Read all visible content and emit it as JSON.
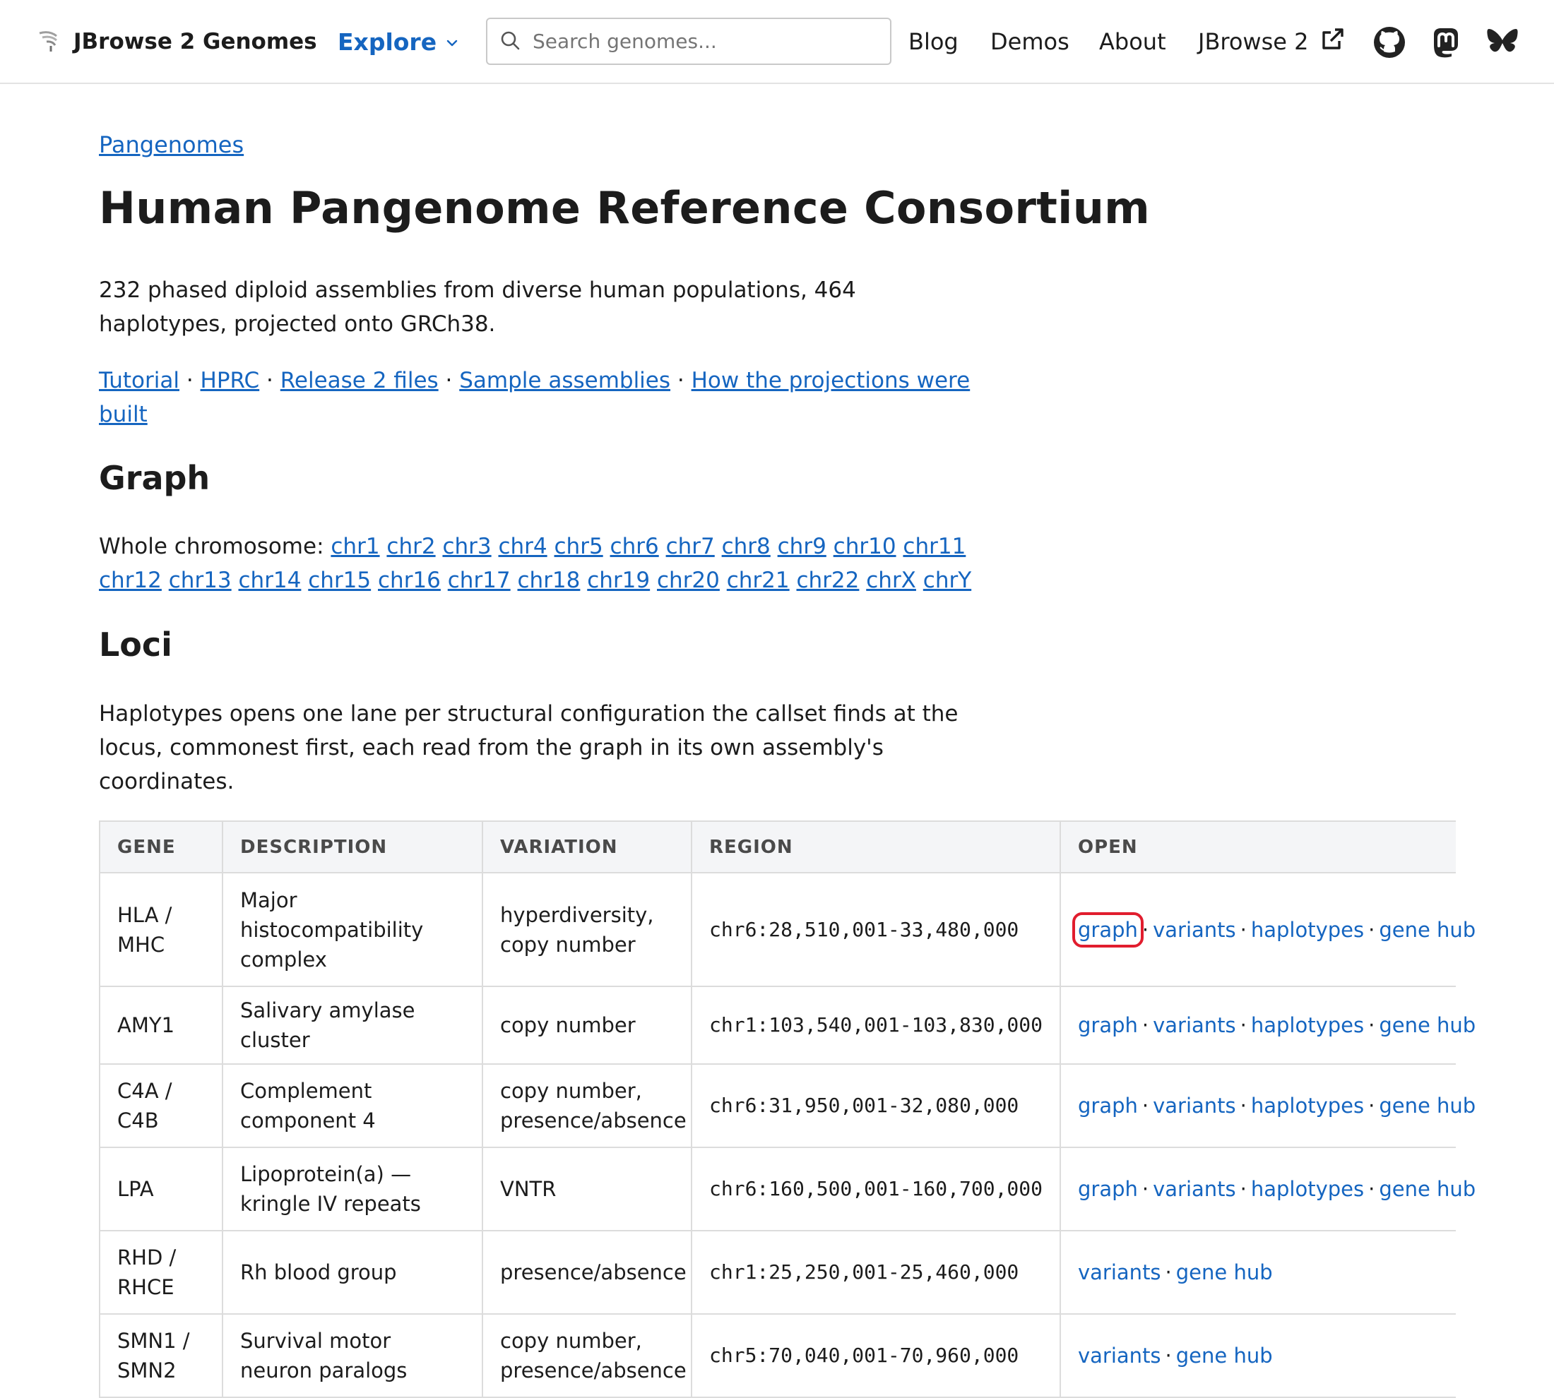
{
  "header": {
    "brand": "JBrowse 2 Genomes",
    "explore": "Explore",
    "search_placeholder": "Search genomes...",
    "nav": [
      "Blog",
      "Demos",
      "About",
      "JBrowse 2"
    ]
  },
  "page": {
    "breadcrumb": "Pangenomes",
    "title": "Human Pangenome Reference Consortium",
    "intro": "232 phased diploid assemblies from diverse human populations, 464 haplotypes, projected onto GRCh38.",
    "links": [
      "Tutorial",
      "HPRC",
      "Release 2 files",
      "Sample assemblies",
      "How the projections were built"
    ],
    "graph_heading": "Graph",
    "whole_chromosome_label": "Whole chromosome:",
    "chromosomes": [
      "chr1",
      "chr2",
      "chr3",
      "chr4",
      "chr5",
      "chr6",
      "chr7",
      "chr8",
      "chr9",
      "chr10",
      "chr11",
      "chr12",
      "chr13",
      "chr14",
      "chr15",
      "chr16",
      "chr17",
      "chr18",
      "chr19",
      "chr20",
      "chr21",
      "chr22",
      "chrX",
      "chrY"
    ],
    "loci_heading": "Loci",
    "loci_text": "Haplotypes opens one lane per structural configuration the callset finds at the locus, commonest first, each read from the graph in its own assembly's coordinates."
  },
  "table": {
    "headers": [
      "GENE",
      "DESCRIPTION",
      "VARIATION",
      "REGION",
      "OPEN"
    ],
    "rows": [
      {
        "gene": "HLA / MHC",
        "description": "Major histocompatibility complex",
        "variation": "hyperdiversity, copy number",
        "region": "chr6:28,510,001-33,480,000",
        "open": [
          "graph",
          "variants",
          "haplotypes",
          "gene hub"
        ]
      },
      {
        "gene": "AMY1",
        "description": "Salivary amylase cluster",
        "variation": "copy number",
        "region": "chr1:103,540,001-103,830,000",
        "open": [
          "graph",
          "variants",
          "haplotypes",
          "gene hub"
        ]
      },
      {
        "gene": "C4A / C4B",
        "description": "Complement component 4",
        "variation": "copy number, presence/absence",
        "region": "chr6:31,950,001-32,080,000",
        "open": [
          "graph",
          "variants",
          "haplotypes",
          "gene hub"
        ]
      },
      {
        "gene": "LPA",
        "description": "Lipoprotein(a) — kringle IV repeats",
        "variation": "VNTR",
        "region": "chr6:160,500,001-160,700,000",
        "open": [
          "graph",
          "variants",
          "haplotypes",
          "gene hub"
        ]
      },
      {
        "gene": "RHD / RHCE",
        "description": "Rh blood group",
        "variation": "presence/absence",
        "region": "chr1:25,250,001-25,460,000",
        "open": [
          "variants",
          "gene hub"
        ]
      },
      {
        "gene": "SMN1 / SMN2",
        "description": "Survival motor neuron paralogs",
        "variation": "copy number, presence/absence",
        "region": "chr5:70,040,001-70,960,000",
        "open": [
          "variants",
          "gene hub"
        ]
      }
    ]
  },
  "icons": {
    "logo": "jbrowse-logo-icon",
    "explore_chevron": "chevron-down-icon",
    "search": "search-icon",
    "external": "external-link-icon",
    "github": "github-icon",
    "mastodon": "mastodon-icon",
    "bluesky": "bluesky-icon"
  },
  "colors": {
    "link": "#1565c0",
    "highlight": "#e11d2e"
  }
}
